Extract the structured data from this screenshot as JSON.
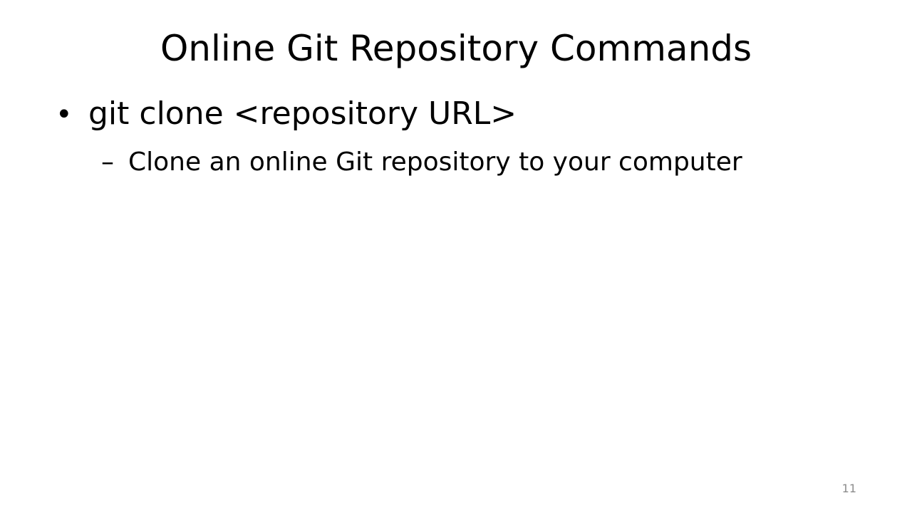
{
  "slide": {
    "title": "Online Git Repository Commands",
    "bullets": [
      {
        "marker": "•",
        "text": "git clone <repository URL>",
        "sub_items": [
          {
            "marker": "–",
            "text": "Clone an online Git repository to your computer"
          }
        ]
      }
    ],
    "page_number": "11",
    "colors": {
      "background": "#ffffff",
      "text": "#000000",
      "page_number": "#8c8c8c"
    }
  }
}
